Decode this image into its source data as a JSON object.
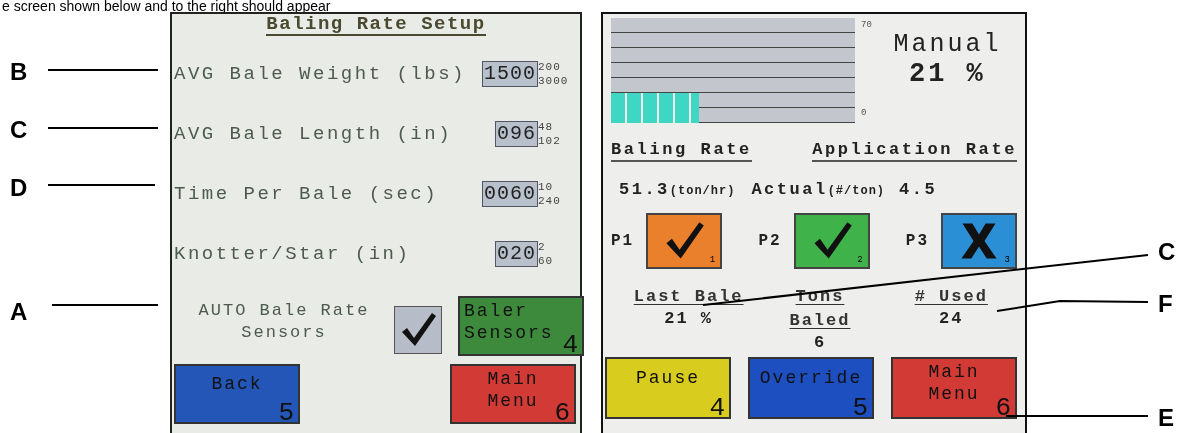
{
  "caption": "e screen shown below and to the right should appear",
  "left_callouts": [
    {
      "letter": "B"
    },
    {
      "letter": "C"
    },
    {
      "letter": "D"
    },
    {
      "letter": "A"
    }
  ],
  "right_callouts": [
    {
      "letter": "C"
    },
    {
      "letter": "F"
    },
    {
      "letter": "E"
    }
  ],
  "setup_screen": {
    "title": "Baling Rate Setup",
    "fields": [
      {
        "label": "AVG Bale Weight (lbs)",
        "value": "1500",
        "min": "200",
        "max": "3000"
      },
      {
        "label": "AVG Bale Length (in)",
        "value": "096",
        "min": "48",
        "max": "102"
      },
      {
        "label": "Time Per Bale (sec)",
        "value": "0060",
        "min": "10",
        "max": "240"
      },
      {
        "label": "Knotter/Star (in)",
        "value": "020",
        "min": "2",
        "max": "60"
      }
    ],
    "auto_sensors": {
      "label": "AUTO Bale Rate Sensors",
      "checked": true
    },
    "buttons": [
      {
        "label": "Baler Sensors",
        "key": "4",
        "color": "#3e8a3c"
      },
      {
        "label": "Back",
        "key": "5",
        "color": "#2456b8"
      },
      {
        "label": "Main Menu",
        "key": "6",
        "color": "#d23a36"
      }
    ]
  },
  "status_screen": {
    "meter": {
      "level": 0.36,
      "max_label": "70",
      "min_label": "0"
    },
    "mode": "Manual",
    "percent": "21 %",
    "headers": [
      "Baling Rate",
      "Application Rate"
    ],
    "baling_rate": {
      "value": "51.3",
      "unit": "(ton/hr)"
    },
    "application_rate": {
      "label": "Actual",
      "unit": "(#/ton)",
      "value": "4.5"
    },
    "pumps": [
      {
        "label": "P1",
        "checked": true,
        "key": "1",
        "color": "#ea7f2c"
      },
      {
        "label": "P2",
        "checked": true,
        "key": "2",
        "color": "#3fb34a"
      },
      {
        "label": "P3",
        "checked": false,
        "key": "3",
        "color": "#2b8fd6"
      }
    ],
    "stats": [
      {
        "label": "Last Bale",
        "value": "21 %"
      },
      {
        "label": "Tons Baled",
        "value": "6"
      },
      {
        "label": "# Used",
        "value": "24"
      }
    ],
    "buttons": [
      {
        "label": "Pause",
        "key": "4",
        "color": "#d8cc1e"
      },
      {
        "label": "Override",
        "key": "5",
        "color": "#1d4fc0"
      },
      {
        "label": "Main Menu",
        "key": "6",
        "color": "#d23a36"
      }
    ]
  }
}
